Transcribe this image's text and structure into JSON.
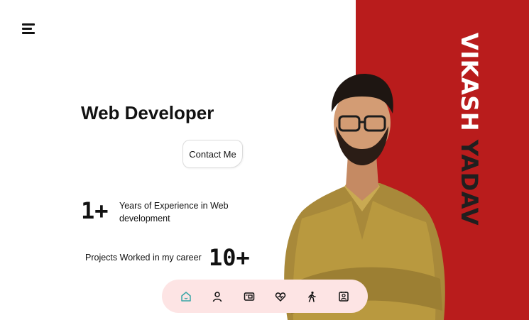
{
  "profile": {
    "first_name": "VIKASH",
    "last_name": "YADAV",
    "role": "Web Developer"
  },
  "contact_button": {
    "label": "Contact Me"
  },
  "stats": [
    {
      "value": "1+",
      "label": "Years of Experience in Web development"
    },
    {
      "value": "10+",
      "label": "Projects Worked in my career"
    }
  ],
  "nav": {
    "items": [
      {
        "icon": "home-icon",
        "active": true
      },
      {
        "icon": "user-icon",
        "active": false
      },
      {
        "icon": "portfolio-icon",
        "active": false
      },
      {
        "icon": "heart-icon",
        "active": false
      },
      {
        "icon": "walk-icon",
        "active": false
      },
      {
        "icon": "contact-card-icon",
        "active": false
      }
    ],
    "active_color": "#3aa6a6",
    "bg_color": "#fde4e4"
  },
  "colors": {
    "accent": "#b91c1c",
    "text": "#111111"
  },
  "menu_icon": "hamburger-menu-icon"
}
